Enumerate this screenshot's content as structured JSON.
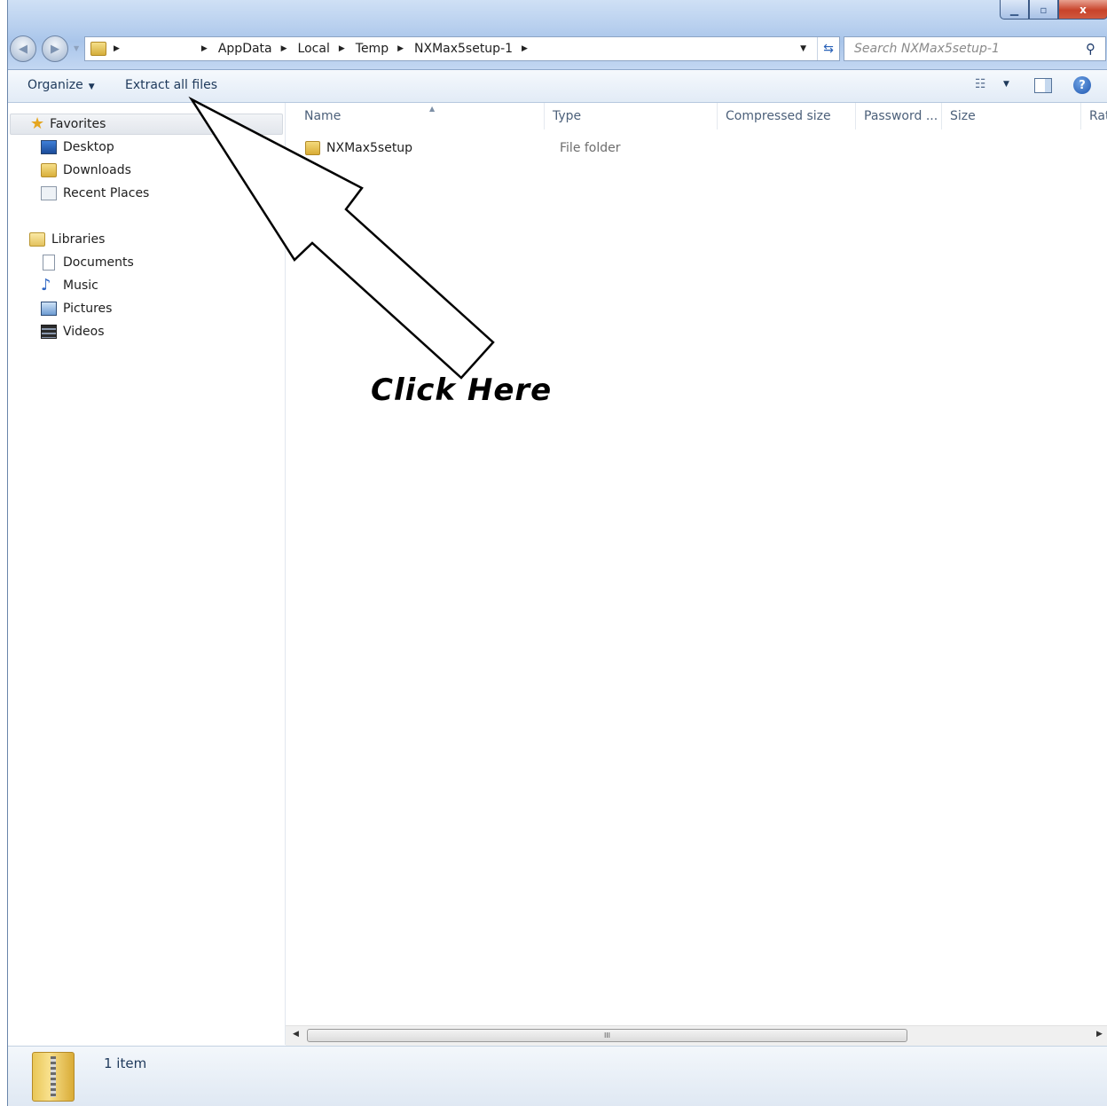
{
  "window": {
    "caption_buttons": {
      "minimize": "▁",
      "maximize": "▫",
      "close": "x"
    }
  },
  "address_bar": {
    "breadcrumbs": [
      "AppData",
      "Local",
      "Temp",
      "NXMax5setup-1"
    ],
    "folder_icon": "folder-icon",
    "refresh_icon": "refresh-icon"
  },
  "search": {
    "placeholder": "Search NXMax5setup-1",
    "icon": "search-icon"
  },
  "toolbar": {
    "organize_label": "Organize",
    "extract_label": "Extract all files",
    "views_icon": "views-icon",
    "preview_icon": "preview-pane-icon",
    "help_icon": "help-icon",
    "help_glyph": "?"
  },
  "sidebar": {
    "favorites": {
      "label": "Favorites",
      "items": [
        {
          "label": "Desktop",
          "icon": "desktop-icon"
        },
        {
          "label": "Downloads",
          "icon": "downloads-icon"
        },
        {
          "label": "Recent Places",
          "icon": "recent-places-icon"
        }
      ]
    },
    "libraries": {
      "label": "Libraries",
      "items": [
        {
          "label": "Documents",
          "icon": "documents-icon"
        },
        {
          "label": "Music",
          "icon": "music-icon"
        },
        {
          "label": "Pictures",
          "icon": "pictures-icon"
        },
        {
          "label": "Videos",
          "icon": "videos-icon"
        }
      ]
    }
  },
  "file_list": {
    "columns": [
      "Name",
      "Type",
      "Compressed size",
      "Password ...",
      "Size",
      "Rat"
    ],
    "rows": [
      {
        "name": "NXMax5setup",
        "type": "File folder",
        "icon": "folder-icon"
      }
    ]
  },
  "scrollbar": {
    "thumb_grip": "III"
  },
  "status": {
    "item_count": "1 item",
    "icon": "zip-folder-icon"
  },
  "annotation": {
    "text": "Click Here"
  }
}
